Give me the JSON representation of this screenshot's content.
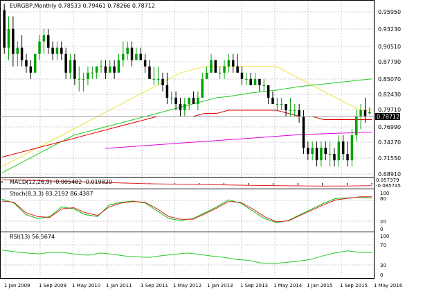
{
  "symbol": "EURGBP,Monthly",
  "ohlc_text": "0.78533 0.79461 0.78266 0.78712",
  "colors": {
    "up": "#00a000",
    "down": "#000000",
    "grid": "#c8c8c8",
    "ma_yellow": "#f0e040",
    "ma_red": "#e00000",
    "ma_green": "#22cc22",
    "ma_magenta": "#e000e0",
    "stoch_main": "#00bb00",
    "stoch_signal": "#e02020",
    "rsi": "#22cc22",
    "macd_signal": "#e02020",
    "current_price_bg": "#000000"
  },
  "price_axis": [
    "0.95950",
    "0.93230",
    "0.90510",
    "0.87790",
    "0.85070",
    "0.82430",
    "0.79710",
    "0.76990",
    "0.74270",
    "0.71550",
    "0.68910"
  ],
  "current_price": "0.78712",
  "macd": {
    "label": "MACD(12,26,9) -0.005482 -0.019820",
    "axis": [
      "0.057379",
      "-0.085745"
    ]
  },
  "stoch": {
    "label": "Stoch(8,3,3) 83.2192 86.4387",
    "axis": [
      "100",
      "80",
      "20",
      "0"
    ]
  },
  "rsi": {
    "label": "RSI(13) 56.5674",
    "axis": [
      "100",
      "70",
      "30",
      "0"
    ]
  },
  "time_axis": [
    "1 Jan 2009",
    "1 Sep 2009",
    "1 May 2010",
    "1 Jan 2011",
    "1 Sep 2011",
    "1 May 2012",
    "1 Jan 2013",
    "1 Sep 2013",
    "1 May 2014",
    "1 Jan 2015",
    "1 Sep 2015",
    "1 May 2016"
  ],
  "chart_data": {
    "type": "candlestick",
    "title": "EURGBP,Monthly",
    "ylim": [
      0.6891,
      0.9595
    ],
    "candles": [
      [
        0.95,
        0.96,
        0.88,
        0.89
      ],
      [
        0.89,
        0.94,
        0.87,
        0.92
      ],
      [
        0.92,
        0.94,
        0.86,
        0.88
      ],
      [
        0.88,
        0.9,
        0.86,
        0.89
      ],
      [
        0.89,
        0.91,
        0.86,
        0.87
      ],
      [
        0.87,
        0.88,
        0.85,
        0.86
      ],
      [
        0.86,
        0.87,
        0.84,
        0.85
      ],
      [
        0.85,
        0.88,
        0.85,
        0.88
      ],
      [
        0.88,
        0.91,
        0.87,
        0.9
      ],
      [
        0.9,
        0.92,
        0.88,
        0.91
      ],
      [
        0.91,
        0.92,
        0.88,
        0.89
      ],
      [
        0.89,
        0.9,
        0.87,
        0.88
      ],
      [
        0.88,
        0.9,
        0.87,
        0.89
      ],
      [
        0.89,
        0.9,
        0.87,
        0.88
      ],
      [
        0.88,
        0.89,
        0.84,
        0.85
      ],
      [
        0.85,
        0.88,
        0.84,
        0.87
      ],
      [
        0.87,
        0.88,
        0.83,
        0.84
      ],
      [
        0.84,
        0.86,
        0.82,
        0.84
      ],
      [
        0.84,
        0.85,
        0.82,
        0.84
      ],
      [
        0.84,
        0.86,
        0.83,
        0.85
      ],
      [
        0.85,
        0.86,
        0.84,
        0.85
      ],
      [
        0.85,
        0.86,
        0.84,
        0.86
      ],
      [
        0.86,
        0.87,
        0.85,
        0.86
      ],
      [
        0.86,
        0.87,
        0.84,
        0.85
      ],
      [
        0.85,
        0.87,
        0.85,
        0.86
      ],
      [
        0.86,
        0.87,
        0.84,
        0.85
      ],
      [
        0.85,
        0.88,
        0.85,
        0.87
      ],
      [
        0.87,
        0.9,
        0.86,
        0.88
      ],
      [
        0.88,
        0.9,
        0.87,
        0.89
      ],
      [
        0.89,
        0.9,
        0.86,
        0.87
      ],
      [
        0.87,
        0.89,
        0.87,
        0.88
      ],
      [
        0.88,
        0.89,
        0.87,
        0.87
      ],
      [
        0.87,
        0.88,
        0.85,
        0.86
      ],
      [
        0.86,
        0.87,
        0.84,
        0.84
      ],
      [
        0.84,
        0.86,
        0.83,
        0.84
      ],
      [
        0.84,
        0.86,
        0.83,
        0.84
      ],
      [
        0.84,
        0.85,
        0.82,
        0.83
      ],
      [
        0.83,
        0.85,
        0.8,
        0.81
      ],
      [
        0.81,
        0.82,
        0.8,
        0.81
      ],
      [
        0.81,
        0.82,
        0.79,
        0.8
      ],
      [
        0.8,
        0.81,
        0.78,
        0.79
      ],
      [
        0.79,
        0.81,
        0.78,
        0.8
      ],
      [
        0.8,
        0.81,
        0.79,
        0.81
      ],
      [
        0.81,
        0.82,
        0.8,
        0.8
      ],
      [
        0.8,
        0.82,
        0.79,
        0.81
      ],
      [
        0.81,
        0.85,
        0.81,
        0.84
      ],
      [
        0.84,
        0.86,
        0.84,
        0.85
      ],
      [
        0.85,
        0.88,
        0.85,
        0.87
      ],
      [
        0.87,
        0.87,
        0.85,
        0.85
      ],
      [
        0.85,
        0.86,
        0.84,
        0.85
      ],
      [
        0.85,
        0.87,
        0.84,
        0.86
      ],
      [
        0.86,
        0.88,
        0.85,
        0.87
      ],
      [
        0.87,
        0.88,
        0.85,
        0.86
      ],
      [
        0.86,
        0.88,
        0.85,
        0.85
      ],
      [
        0.85,
        0.86,
        0.83,
        0.84
      ],
      [
        0.84,
        0.85,
        0.83,
        0.84
      ],
      [
        0.84,
        0.85,
        0.83,
        0.83
      ],
      [
        0.83,
        0.85,
        0.83,
        0.84
      ],
      [
        0.84,
        0.84,
        0.82,
        0.83
      ],
      [
        0.83,
        0.84,
        0.82,
        0.83
      ],
      [
        0.83,
        0.83,
        0.8,
        0.81
      ],
      [
        0.81,
        0.82,
        0.8,
        0.8
      ],
      [
        0.8,
        0.81,
        0.79,
        0.8
      ],
      [
        0.8,
        0.81,
        0.79,
        0.8
      ],
      [
        0.8,
        0.8,
        0.78,
        0.79
      ],
      [
        0.79,
        0.81,
        0.78,
        0.79
      ],
      [
        0.79,
        0.8,
        0.78,
        0.79
      ],
      [
        0.79,
        0.8,
        0.77,
        0.78
      ],
      [
        0.78,
        0.79,
        0.72,
        0.73
      ],
      [
        0.73,
        0.74,
        0.71,
        0.72
      ],
      [
        0.72,
        0.74,
        0.71,
        0.73
      ],
      [
        0.73,
        0.74,
        0.7,
        0.71
      ],
      [
        0.71,
        0.74,
        0.7,
        0.73
      ],
      [
        0.73,
        0.74,
        0.71,
        0.72
      ],
      [
        0.72,
        0.74,
        0.7,
        0.72
      ],
      [
        0.72,
        0.73,
        0.7,
        0.71
      ],
      [
        0.71,
        0.75,
        0.7,
        0.74
      ],
      [
        0.74,
        0.75,
        0.71,
        0.72
      ],
      [
        0.72,
        0.74,
        0.7,
        0.71
      ],
      [
        0.71,
        0.76,
        0.7,
        0.75
      ],
      [
        0.75,
        0.79,
        0.74,
        0.78
      ],
      [
        0.78,
        0.8,
        0.76,
        0.79
      ],
      [
        0.79,
        0.81,
        0.77,
        0.78
      ],
      [
        0.785,
        0.795,
        0.783,
        0.787
      ]
    ],
    "ma_yellow": [
      0.7,
      0.71,
      0.72,
      0.73,
      0.74,
      0.75,
      0.76,
      0.77,
      0.78,
      0.79,
      0.8,
      0.81,
      0.82,
      0.83,
      0.84,
      0.85,
      0.855,
      0.86,
      0.86,
      0.86,
      0.86,
      0.86,
      0.86,
      0.86,
      0.85,
      0.84,
      0.83,
      0.82,
      0.81,
      0.8,
      0.79,
      0.79
    ],
    "ma_red": [
      0.715,
      0.72,
      0.725,
      0.73,
      0.735,
      0.74,
      0.745,
      0.75,
      0.755,
      0.76,
      0.765,
      0.77,
      0.775,
      0.78,
      0.78,
      0.78,
      0.78,
      0.785,
      0.785,
      0.79,
      0.79,
      0.79,
      0.79,
      0.79,
      0.785,
      0.78,
      0.78,
      0.775,
      0.775,
      0.775,
      0.775,
      0.775
    ],
    "ma_green": [
      0.69,
      0.7,
      0.71,
      0.72,
      0.73,
      0.74,
      0.75,
      0.755,
      0.76,
      0.765,
      0.77,
      0.775,
      0.78,
      0.785,
      0.79,
      0.795,
      0.8,
      0.805,
      0.81,
      0.812,
      0.815,
      0.818,
      0.82,
      0.822,
      0.825,
      0.828,
      0.83,
      0.832,
      0.834,
      0.836,
      0.838,
      0.84
    ],
    "ma_magenta": [
      0.729,
      0.731,
      0.733,
      0.735,
      0.737,
      0.739,
      0.741,
      0.743,
      0.745,
      0.747,
      0.749,
      0.751,
      0.752,
      0.753,
      0.754,
      0.755
    ],
    "macd_main": [
      0.02,
      0.015,
      0.01,
      0.005,
      0.0,
      -0.005,
      -0.008,
      -0.01,
      -0.012,
      -0.015,
      -0.018,
      -0.02,
      -0.022,
      -0.025,
      -0.02,
      -0.015
    ],
    "macd_signal": [
      0.025,
      0.02,
      0.015,
      0.01,
      0.005,
      0.0,
      -0.005,
      -0.008,
      -0.01,
      -0.013,
      -0.016,
      -0.018,
      -0.02,
      -0.022,
      -0.021,
      -0.019
    ],
    "stoch_main": [
      80,
      70,
      40,
      30,
      35,
      60,
      55,
      40,
      35,
      65,
      72,
      75,
      70,
      50,
      30,
      25,
      30,
      45,
      60,
      78,
      70,
      50,
      30,
      20,
      25,
      40,
      55,
      70,
      82,
      83,
      85,
      83
    ],
    "stoch_signal": [
      75,
      72,
      45,
      35,
      33,
      55,
      58,
      45,
      38,
      60,
      70,
      74,
      72,
      55,
      35,
      28,
      28,
      42,
      57,
      74,
      72,
      55,
      35,
      22,
      24,
      38,
      52,
      66,
      78,
      82,
      86,
      86
    ],
    "rsi": [
      62,
      58,
      55,
      53,
      57,
      56,
      52,
      50,
      55,
      52,
      48,
      46,
      45,
      49,
      52,
      55,
      52,
      48,
      45,
      40,
      38,
      32,
      30,
      33,
      36,
      40,
      48,
      55,
      60,
      57,
      56
    ],
    "rsi_ylim": [
      0,
      100
    ]
  }
}
